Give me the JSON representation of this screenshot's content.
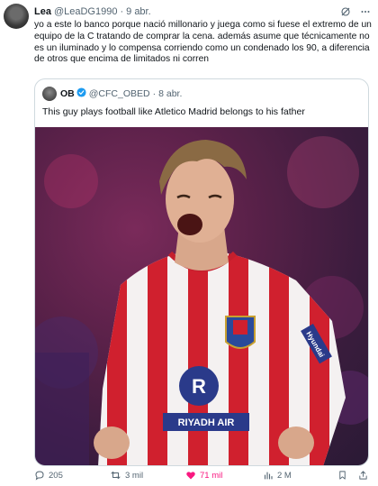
{
  "author": {
    "name": "Lea",
    "handle": "@LeaDG1990",
    "time": "9 abr."
  },
  "tweet_text": "yo a este lo banco porque nació millonario y juega como si fuese el extremo de un equipo de la C tratando de comprar la cena. además asume que técnicamente no es un iluminado y lo compensa corriendo como un condenado los 90, a diferencia de otros que encima de limitados ni corren",
  "quoted": {
    "name": "OB",
    "handle": "@CFC_OBED",
    "time": "8 abr.",
    "text": "This guy plays football like Atletico Madrid belongs to his father",
    "photo": {
      "sponsor": "RIYADH AIR",
      "sleeve_text": "Hyundai"
    }
  },
  "actions": {
    "replies": "205",
    "reposts": "3 mil",
    "likes": "71 mil",
    "views": "2 M"
  },
  "icons": [
    "grok-icon",
    "more-icon",
    "verified-icon",
    "reply-icon",
    "repost-icon",
    "like-icon",
    "views-icon",
    "bookmark-icon",
    "share-icon"
  ],
  "colors": {
    "text": "#0f1419",
    "secondary": "#536471",
    "like": "#f91880",
    "verified": "#1d9bf0",
    "border": "#cfd9de"
  }
}
